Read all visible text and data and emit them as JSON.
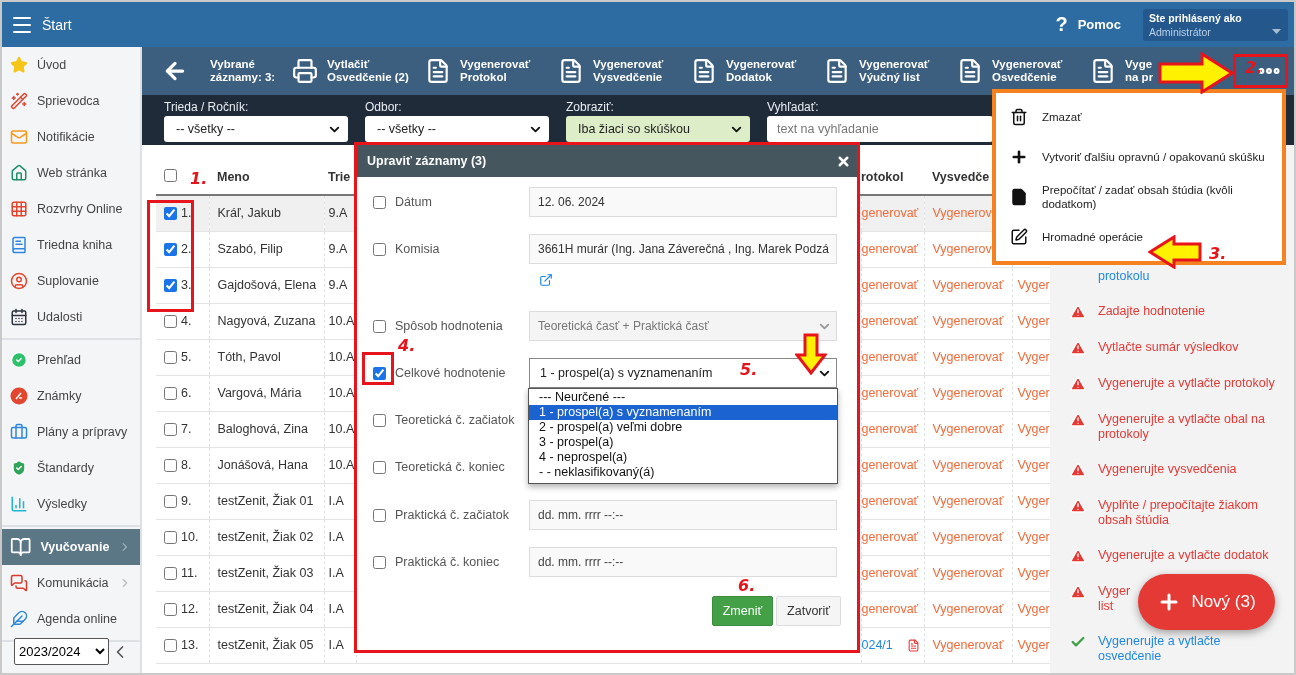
{
  "topbar": {
    "title": "Štart",
    "help_icon": "?",
    "help": "Pomoc",
    "user_caption": "Ste prihlásený ako",
    "user_name": "Administrátor"
  },
  "sidebar": {
    "groups": [
      [
        {
          "label": "Úvod",
          "selected": false,
          "expandable": false
        },
        {
          "label": "Sprievodca",
          "selected": false,
          "expandable": false
        },
        {
          "label": "Notifikácie",
          "selected": false,
          "expandable": false
        },
        {
          "label": "Web stránka",
          "selected": false,
          "expandable": false
        },
        {
          "label": "Rozvrhy Online",
          "selected": false,
          "expandable": false
        },
        {
          "label": "Triedna kniha",
          "selected": false,
          "expandable": false
        },
        {
          "label": "Suplovanie",
          "selected": false,
          "expandable": false
        },
        {
          "label": "Udalosti",
          "selected": false,
          "expandable": false
        }
      ],
      [
        {
          "label": "Prehľad",
          "selected": false,
          "expandable": false
        },
        {
          "label": "Známky",
          "selected": false,
          "expandable": false
        },
        {
          "label": "Plány a prípravy",
          "selected": false,
          "expandable": false
        },
        {
          "label": "Štandardy",
          "selected": false,
          "expandable": false
        },
        {
          "label": "Výsledky",
          "selected": false,
          "expandable": false
        }
      ],
      [
        {
          "label": "Vyučovanie",
          "selected": true,
          "expandable": true
        },
        {
          "label": "Komunikácia",
          "selected": false,
          "expandable": true
        },
        {
          "label": "Agenda online",
          "selected": false,
          "expandable": false
        }
      ]
    ],
    "year": "2023/2024"
  },
  "toolbar": {
    "selected_label": "Vybrané záznamy: 3:",
    "actions": [
      {
        "lines": [
          "Vytlačiť",
          "Osvedčenie (2)"
        ]
      },
      {
        "lines": [
          "Vygenerovať",
          "Protokol"
        ]
      },
      {
        "lines": [
          "Vygenerovať",
          "Vysvedčenie"
        ]
      },
      {
        "lines": [
          "Vygenerovať",
          "Dodatok"
        ]
      },
      {
        "lines": [
          "Vygenerovať",
          "Výučný list"
        ]
      },
      {
        "lines": [
          "Vygenerovať",
          "Osvedčenie"
        ]
      },
      {
        "lines": [
          "Vyge",
          "na pr"
        ]
      }
    ]
  },
  "filters": [
    {
      "kind": "select",
      "label": "Trieda / Ročník:",
      "value": "-- všetky --",
      "highlighted": false
    },
    {
      "kind": "select",
      "label": "Odbor:",
      "value": "-- všetky --",
      "highlighted": false
    },
    {
      "kind": "select",
      "label": "Zobraziť:",
      "value": "Iba žiaci so skúškou",
      "highlighted": true
    },
    {
      "kind": "search",
      "label": "Vyhľadať:",
      "placeholder": "text na vyhľadanie"
    }
  ],
  "table": {
    "select_all": {
      "checked": false
    },
    "columns": [
      "Meno",
      "Trie",
      "rotokol",
      "Vysvedče"
    ],
    "rows": [
      {
        "number": "1.",
        "checked": true,
        "highlighted": true,
        "name": "Kráľ, Jakub",
        "class": "9.A",
        "protokol": {
          "kind": "action",
          "text": "generovať"
        },
        "vysvedcenie": "Vygenerov"
      },
      {
        "number": "2.",
        "checked": true,
        "highlighted": false,
        "name": "Szabó, Filip",
        "class": "9.A",
        "protokol": {
          "kind": "action",
          "text": "generovať"
        },
        "vysvedcenie": "Vygenerov"
      },
      {
        "number": "3.",
        "checked": true,
        "highlighted": false,
        "name": "Gajdošová, Elena",
        "class": "9.A",
        "protokol": {
          "kind": "action",
          "text": "generovať"
        },
        "vysvedcenie": "Vygenerovať",
        "column_7": "Vyger"
      },
      {
        "number": "4.",
        "checked": false,
        "highlighted": false,
        "name": "Nagyová, Zuzana",
        "class": "10.A",
        "protokol": {
          "kind": "action",
          "text": "generovať"
        },
        "vysvedcenie": "Vygenerovať",
        "column_7": "Vyger"
      },
      {
        "number": "5.",
        "checked": false,
        "highlighted": false,
        "name": "Tóth, Pavol",
        "class": "10.A",
        "protokol": {
          "kind": "action",
          "text": "generovať"
        },
        "vysvedcenie": "Vygenerovať",
        "column_7": "Vyger"
      },
      {
        "number": "6.",
        "checked": false,
        "highlighted": false,
        "name": "Vargová, Mária",
        "class": "10.A",
        "protokol": {
          "kind": "action",
          "text": "generovať"
        },
        "vysvedcenie": "Vygenerovať",
        "column_7": "Vyger"
      },
      {
        "number": "7.",
        "checked": false,
        "highlighted": false,
        "name": "Baloghová, Zina",
        "class": "10.A",
        "protokol": {
          "kind": "action",
          "text": "generovať"
        },
        "vysvedcenie": "Vygenerovať",
        "column_7": "Vyger"
      },
      {
        "number": "8.",
        "checked": false,
        "highlighted": false,
        "name": "Jonášová, Hana",
        "class": "10.A",
        "protokol": {
          "kind": "action",
          "text": "generovať"
        },
        "vysvedcenie": "Vygenerovať",
        "column_7": "Vyger"
      },
      {
        "number": "9.",
        "checked": false,
        "highlighted": false,
        "name": "testZenit, Žiak 01",
        "class": "I.A",
        "protokol": {
          "kind": "action",
          "text": "generovať"
        },
        "vysvedcenie": "Vygenerovať",
        "column_7": "Vyger"
      },
      {
        "number": "10.",
        "checked": false,
        "highlighted": false,
        "name": "testZenit, Žiak 02",
        "class": "I.A",
        "protokol": {
          "kind": "action",
          "text": "generovať"
        },
        "vysvedcenie": "Vygenerovať",
        "column_7": "Vyger"
      },
      {
        "number": "11.",
        "checked": false,
        "highlighted": false,
        "name": "testZenit, Žiak 03",
        "class": "I.A",
        "protokol": {
          "kind": "action",
          "text": "generovať"
        },
        "vysvedcenie": "Vygenerovať",
        "column_7": "Vyger"
      },
      {
        "number": "12.",
        "checked": false,
        "highlighted": false,
        "name": "testZenit, Žiak 04",
        "class": "I.A",
        "protokol": {
          "kind": "action",
          "text": "generovať"
        },
        "vysvedcenie": "Vygenerovať",
        "column_7": "Vyger"
      },
      {
        "number": "13.",
        "checked": false,
        "highlighted": false,
        "name": "testZenit, Žiak 05",
        "class": "I.A",
        "protokol": {
          "kind": "document",
          "text": "024/1"
        },
        "vysvedcenie": "Vygenerovať",
        "column_7": "Vyger"
      }
    ]
  },
  "tasks": [
    {
      "kind": "covered",
      "lines": [
        "protokolu"
      ]
    },
    {
      "kind": "warning",
      "lines": [
        "Zadajte hodnotenie"
      ]
    },
    {
      "kind": "warning",
      "lines": [
        "Vytlačte sumár výsledkov"
      ]
    },
    {
      "kind": "warning",
      "lines": [
        "Vygenerujte a vytlačte protokoly"
      ]
    },
    {
      "kind": "warning",
      "lines": [
        "Vygenerujte a vytlačte obal na",
        "protokoly"
      ]
    },
    {
      "kind": "warning",
      "lines": [
        "Vygenerujte vysvedčenia"
      ]
    },
    {
      "kind": "warning",
      "lines": [
        "Vyplňte / prepočítajte žiakom",
        "obsah štúdia"
      ]
    },
    {
      "kind": "warning",
      "lines": [
        "Vygenerujte a vytlačte dodatok"
      ]
    },
    {
      "kind": "warning",
      "lines": [
        "Vyger",
        "list"
      ]
    },
    {
      "kind": "done",
      "lines": [
        "Vygenerujte a vytlačte",
        "osvedčenie"
      ]
    }
  ],
  "menu": {
    "items": [
      {
        "lines": [
          "Zmazať"
        ]
      },
      {
        "lines": [
          "Vytvoriť ďalšiu opravnú / opakovanú skúšku"
        ]
      },
      {
        "lines": [
          "Prepočítať / zadať obsah štúdia (kvôli",
          "dodatkom)"
        ]
      },
      {
        "lines": [
          "Hromadné operácie"
        ]
      }
    ]
  },
  "dialog": {
    "title": "Upraviť záznamy (3)",
    "fields": [
      {
        "kind": "input",
        "label": "Dátum",
        "checked": false,
        "value": "12. 06. 2024"
      },
      {
        "kind": "input_link",
        "label": "Komisia",
        "checked": false,
        "value": "3661H murár (Ing. Jana Záverečná , Ing. Marek Podzá"
      },
      {
        "kind": "select",
        "label": "Spôsob hodnotenia",
        "checked": false,
        "disabled": true,
        "value": "Teoretická časť + Praktická časť"
      },
      {
        "kind": "select",
        "label": "Celkové hodnotenie",
        "checked": true,
        "disabled": false,
        "value": "1 - prospel(a) s vyznamenaním",
        "expanded": true,
        "options": [
          {
            "label": "--- Neurčené ---",
            "selected": false
          },
          {
            "label": "1 - prospel(a) s vyznamenaním",
            "selected": true
          },
          {
            "label": "2 - prospel(a) veľmi dobre",
            "selected": false
          },
          {
            "label": "3 - prospel(a)",
            "selected": false
          },
          {
            "label": "4 - neprospel(a)",
            "selected": false
          },
          {
            "label": "- - neklasifikovaný(á)",
            "selected": false
          }
        ]
      },
      {
        "kind": "covered",
        "label": "Teoretická č. začiatok",
        "checked": false
      },
      {
        "kind": "covered",
        "label": "Teoretická č. koniec",
        "checked": false
      },
      {
        "kind": "datetime",
        "label": "Praktická č. začiatok",
        "checked": false,
        "placeholder": "dd. mm. rrrr --:--"
      },
      {
        "kind": "datetime",
        "label": "Praktická č. koniec",
        "checked": false,
        "placeholder": "dd. mm. rrrr --:--"
      }
    ],
    "buttons": [
      {
        "kind": "primary",
        "label": "Zmeniť"
      },
      {
        "kind": "secondary",
        "label": "Zatvoriť"
      }
    ]
  },
  "fab": {
    "label": "Nový (3)"
  },
  "annotations": {
    "steps": [
      "1.",
      "2.",
      "3.",
      "4.",
      "5.",
      "6."
    ]
  }
}
